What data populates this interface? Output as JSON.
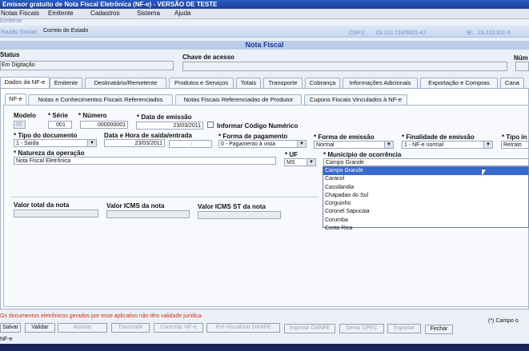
{
  "window": {
    "title": "Emissor gratuito de Nota Fiscal Eletrônica (NF-e) - VERSÃO DE TESTE"
  },
  "menu": {
    "items": [
      "Notas Fiscais",
      "Emitente",
      "Cadastros",
      "Sistema",
      "Ajuda"
    ]
  },
  "info": {
    "emitente_label": "Emitente",
    "razao_label": "Razão Social:",
    "razao_value": "Correio do Estado",
    "cnpj_label": "CNPJ:",
    "cnpj_value": "03.110.724/0001-47",
    "ie_label": "IE:",
    "ie_value": "28.222.811-6"
  },
  "section_title": "Nota Fiscal",
  "status": {
    "label": "Status",
    "value": "Em Digitação"
  },
  "chave": {
    "label": "Chave de acesso",
    "value": ""
  },
  "numero_label": "Núm",
  "tabs_main": [
    "Dados da NF-e",
    "Emitente",
    "Destinatário/Remetente",
    "Produtos e Serviços",
    "Totais",
    "Transporte",
    "Cobrança",
    "Informações Adicionais",
    "Exportação e Compras",
    "Cana"
  ],
  "tabs_sub": [
    "NF-e",
    "Notas e Conhecimentos Fiscais Referenciados",
    "Notas Fiscais Referenciadas de Produtor",
    "Cupons Fiscais Vinculados à NF-e"
  ],
  "form": {
    "modelo_label": "Modelo",
    "modelo_value": "55",
    "serie_label": "* Série",
    "serie_value": "001",
    "numero_label": "* Número",
    "numero_value": "000000001",
    "data_emissao_label": "* Data de emissão",
    "data_emissao_value": "23/03/2011",
    "informar_codigo_label": "Informar Código Numérico",
    "tipo_doc_label": "* Tipo do documento",
    "tipo_doc_value": "1 - Saída",
    "data_saida_label": "Data e Hora de saída/entrada",
    "data_saida_value": "23/03/2011",
    "hora_saida_value": " : ",
    "forma_pag_label": "* Forma de pagamento",
    "forma_pag_value": "0 - Pagamento à vista",
    "forma_emissao_label": "* Forma de emissão",
    "forma_emissao_value": "Normal",
    "finalidade_label": "* Finalidade de emissão",
    "finalidade_value": "1 - NF-e normal",
    "tipo_imp_label": "* Tipo in",
    "tipo_imp_value": "Retrato",
    "natureza_label": "* Natureza da operação",
    "natureza_value": "Nota Fiscal Eletrônica",
    "uf_label": "* UF",
    "uf_value": "MS",
    "municipio_label": "* Município de ocorrência",
    "municipio_value": "Campo Grande",
    "municipio_options": [
      "Campo Grande",
      "Caracol",
      "Cassilandia",
      "Chapadao do Sul",
      "Corguinho",
      "Coronel Sapucaia",
      "Corumba",
      "Costa Rica"
    ],
    "municipio_selected": "Campo Grande",
    "valor_total_label": "Valor total da nota",
    "valor_icms_label": "Valor ICMS da nota",
    "valor_icms_st_label": "Valor ICMS ST da nota"
  },
  "footer": {
    "warning": "Os documentos eletrônicos gerados por esse aplicativo não têm validade jurídica",
    "required_note": "(*) Campo o",
    "buttons": [
      "Salvar",
      "Validar",
      "Assinar",
      "Transmitir",
      "Cancelar NF-e",
      "Pré-Visualizar DANFE",
      "Imprimir DANFE",
      "Gerar DPEC",
      "Exportar",
      "Fechar"
    ]
  },
  "status_bar": {
    "text": "NF-e"
  },
  "colors": {
    "title_bar": "#1b3f98",
    "selection": "#3a67d0",
    "warning": "#d42a1a"
  }
}
